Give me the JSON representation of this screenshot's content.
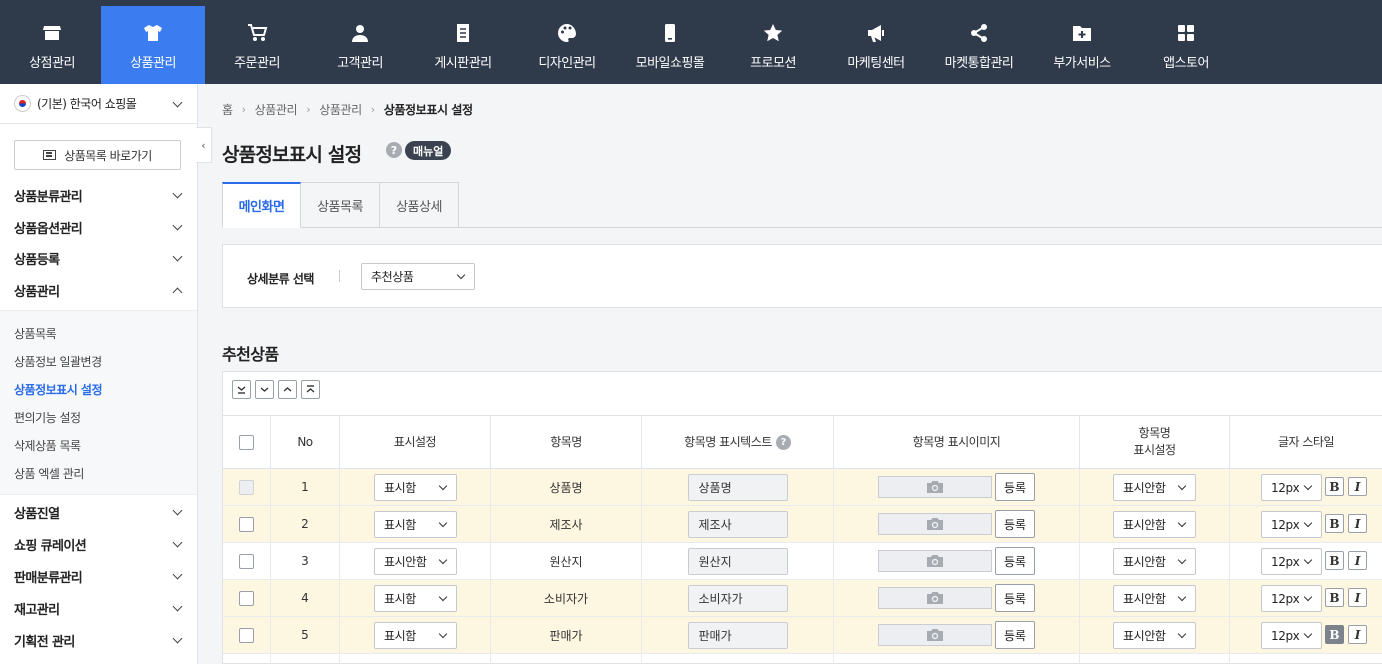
{
  "nav": [
    {
      "label": "상점관리",
      "icon": "store-icon",
      "active": false
    },
    {
      "label": "상품관리",
      "icon": "tshirt-icon",
      "active": true
    },
    {
      "label": "주문관리",
      "icon": "cart-icon",
      "active": false
    },
    {
      "label": "고객관리",
      "icon": "person-icon",
      "active": false
    },
    {
      "label": "게시판관리",
      "icon": "document-icon",
      "active": false
    },
    {
      "label": "디자인관리",
      "icon": "palette-icon",
      "active": false
    },
    {
      "label": "모바일쇼핑몰",
      "icon": "mobile-icon",
      "active": false
    },
    {
      "label": "프로모션",
      "icon": "star-icon",
      "active": false
    },
    {
      "label": "마케팅센터",
      "icon": "megaphone-icon",
      "active": false
    },
    {
      "label": "마켓통합관리",
      "icon": "share-icon",
      "active": false
    },
    {
      "label": "부가서비스",
      "icon": "folder-plus-icon",
      "active": false
    },
    {
      "label": "앱스토어",
      "icon": "apps-grid-icon",
      "active": false
    }
  ],
  "sidebar": {
    "mall": "(기본) 한국어 쇼핑몰",
    "shortcut": "상품목록 바로가기",
    "menus_top": [
      "상품분류관리",
      "상품옵션관리",
      "상품등록",
      "상품관리"
    ],
    "sub_items": [
      "상품목록",
      "상품정보 일괄변경",
      "상품정보표시 설정",
      "편의기능 설정",
      "삭제상품 목록",
      "상품 엑셀 관리"
    ],
    "menus_bottom": [
      "상품진열",
      "쇼핑 큐레이션",
      "판매분류관리",
      "재고관리",
      "기획전 관리"
    ]
  },
  "breadcrumb": [
    "홈",
    "상품관리",
    "상품관리",
    "상품정보표시 설정"
  ],
  "page": {
    "title": "상품정보표시 설정",
    "help": "?",
    "manual": "매뉴얼"
  },
  "tabs": [
    "메인화면",
    "상품목록",
    "상품상세"
  ],
  "filter": {
    "label": "상세분류 선택",
    "value": "추천상품"
  },
  "section_title": "추천상품",
  "table": {
    "headers": [
      "No",
      "표시설정",
      "항목명",
      "항목명 표시텍스트",
      "항목명 표시이미지",
      "항목명\n표시설정",
      "글자 스타일"
    ],
    "header_help": "?",
    "register_label": "등록",
    "bold_label": "B",
    "italic_label": "I",
    "rows": [
      {
        "no": "1",
        "display": "표시함",
        "name": "상품명",
        "text": "상품명",
        "name_display": "표시안함",
        "size": "12px",
        "bold_on": false,
        "highlight": true,
        "checkbox_disabled": true
      },
      {
        "no": "2",
        "display": "표시함",
        "name": "제조사",
        "text": "제조사",
        "name_display": "표시안함",
        "size": "12px",
        "bold_on": false,
        "highlight": true,
        "checkbox_disabled": false
      },
      {
        "no": "3",
        "display": "표시안함",
        "name": "원산지",
        "text": "원산지",
        "name_display": "표시안함",
        "size": "12px",
        "bold_on": false,
        "highlight": false,
        "checkbox_disabled": false
      },
      {
        "no": "4",
        "display": "표시함",
        "name": "소비자가",
        "text": "소비자가",
        "name_display": "표시안함",
        "size": "12px",
        "bold_on": false,
        "highlight": true,
        "checkbox_disabled": false
      },
      {
        "no": "5",
        "display": "표시함",
        "name": "판매가",
        "text": "판매가",
        "name_display": "표시안함",
        "size": "12px",
        "bold_on": true,
        "highlight": true,
        "checkbox_disabled": false
      }
    ]
  },
  "colors": {
    "nav_bg": "#2f3a4b",
    "accent": "#3b7df0",
    "row_highlight": "#fdf6e0"
  }
}
